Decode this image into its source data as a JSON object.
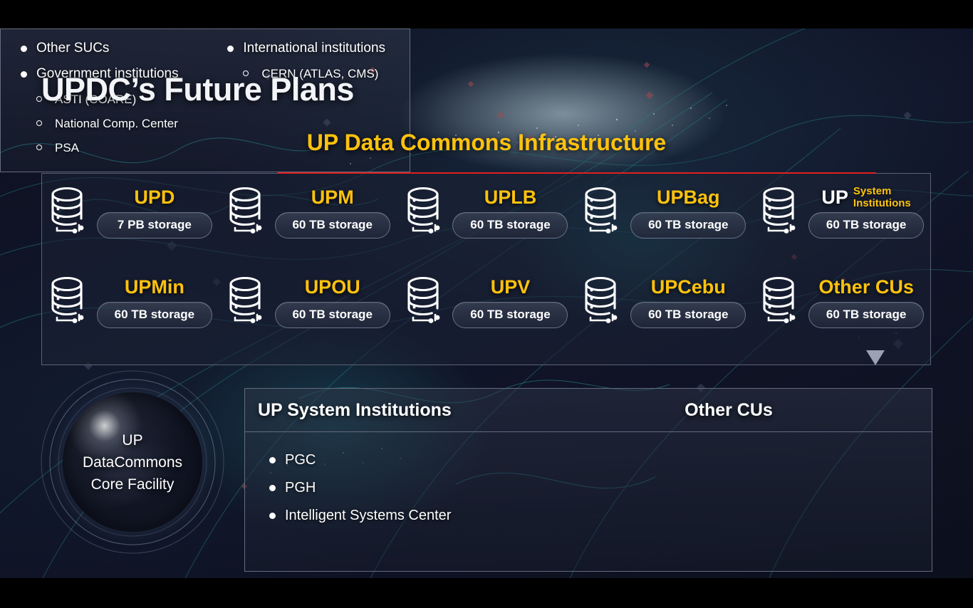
{
  "slide": {
    "page_title": "UPDC’s Future Plans",
    "section_title": "UP Data Commons Infrastructure"
  },
  "colors": {
    "accent_gold": "#ffc20e",
    "rule_red": "#e02020",
    "panel_border": "#656c80",
    "text_white": "#ffffff",
    "background_dark": "#0d1120"
  },
  "grid": {
    "rows": [
      [
        {
          "label": "UPD",
          "label_main": null,
          "label_sub": null,
          "storage": "7 PB storage",
          "icon": "database-icon"
        },
        {
          "label": "UPM",
          "label_main": null,
          "label_sub": null,
          "storage": "60 TB storage",
          "icon": "database-icon"
        },
        {
          "label": "UPLB",
          "label_main": null,
          "label_sub": null,
          "storage": "60 TB storage",
          "icon": "database-icon"
        },
        {
          "label": "UPBag",
          "label_main": null,
          "label_sub": null,
          "storage": "60 TB storage",
          "icon": "database-icon"
        },
        {
          "label": null,
          "label_main": "UP",
          "label_sub_line1": "System",
          "label_sub_line2": "Institutions",
          "storage": "60 TB storage",
          "icon": "database-icon"
        }
      ],
      [
        {
          "label": "UPMin",
          "storage": "60 TB storage",
          "icon": "database-icon"
        },
        {
          "label": "UPOU",
          "storage": "60 TB storage",
          "icon": "database-icon"
        },
        {
          "label": "UPV",
          "storage": "60 TB storage",
          "icon": "database-icon"
        },
        {
          "label": "UPCebu",
          "storage": "60 TB storage",
          "icon": "database-icon"
        },
        {
          "label": "Other CUs",
          "storage": "60 TB storage",
          "icon": "database-icon"
        }
      ]
    ]
  },
  "core_facility": {
    "line1": "UP",
    "line2": "DataCommons",
    "line3": "Core Facility"
  },
  "panels": {
    "up_system_institutions": {
      "title": "UP System Institutions",
      "items": [
        {
          "level": 1,
          "text": "PGC"
        },
        {
          "level": 1,
          "text": "PGH"
        },
        {
          "level": 1,
          "text": "Intelligent Systems Center"
        }
      ]
    },
    "other_cus": {
      "title": "Other CUs",
      "left_items": [
        {
          "level": 1,
          "text": "Other SUCs"
        },
        {
          "level": 1,
          "text": "Government institutions"
        },
        {
          "level": 2,
          "text": "ASTI (COARE)"
        },
        {
          "level": 2,
          "text": "National Comp. Center"
        },
        {
          "level": 2,
          "text": "PSA"
        }
      ],
      "right_items": [
        {
          "level": 1,
          "text": "International institutions"
        },
        {
          "level": 2,
          "text": "CERN (ATLAS, CMS)"
        }
      ]
    }
  }
}
